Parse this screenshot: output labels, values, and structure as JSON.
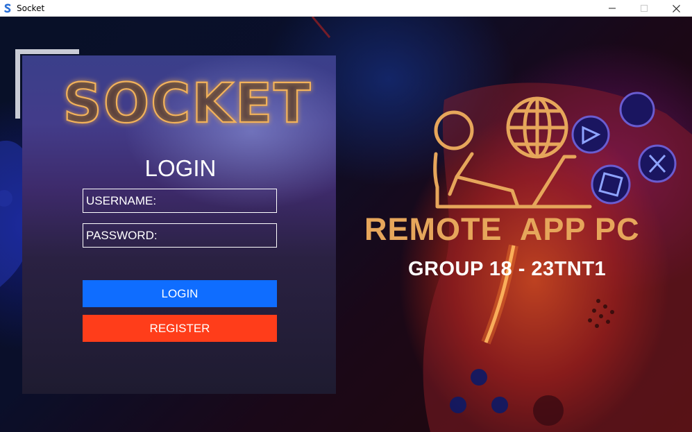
{
  "window": {
    "title": "Socket",
    "minimize_icon": "minimize-icon",
    "maximize_icon": "maximize-icon",
    "close_icon": "close-icon"
  },
  "login_panel": {
    "logo_text": "SOCKET",
    "heading": "LOGIN",
    "username_placeholder": "USERNAME:",
    "password_placeholder": "PASSWORD:",
    "login_button": "LOGIN",
    "register_button": "REGISTER"
  },
  "branding": {
    "title": "REMOTE  APP PC",
    "subtitle": "GROUP 18 - 23TNT1",
    "icon": "remote-user-globe-icon"
  },
  "colors": {
    "login_button": "#0f6dff",
    "register_button": "#ff3d1a",
    "brand_orange": "#e6a65b",
    "logo_glow": "#f0a040"
  }
}
